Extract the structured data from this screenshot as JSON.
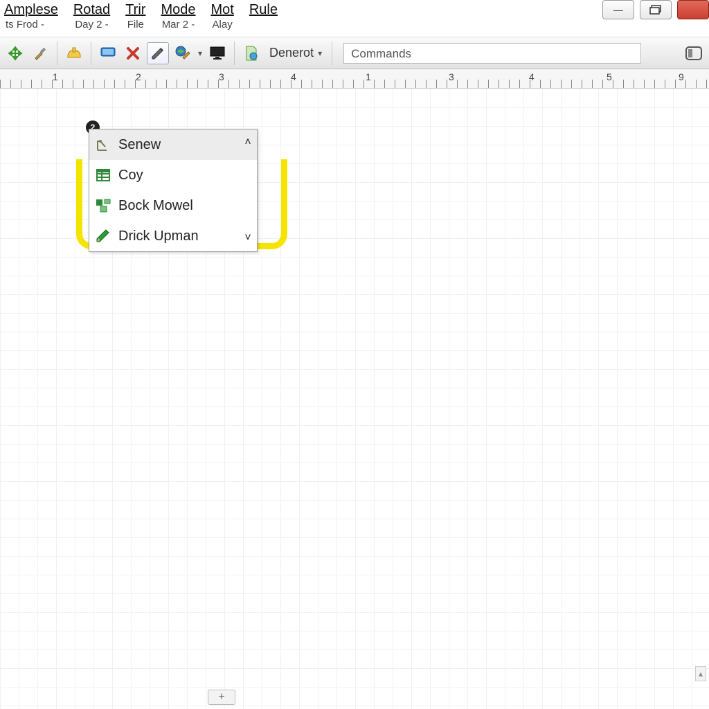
{
  "menubar": {
    "items": [
      {
        "top": "Amplese",
        "sub": "ts    Frod",
        "sub_has_caret": true
      },
      {
        "top": "Rotad",
        "sub": "Day 2",
        "sub_has_caret": true
      },
      {
        "top": "Trir",
        "sub": "File",
        "sub_has_caret": false
      },
      {
        "top": "Mode",
        "sub": "Mar 2",
        "sub_has_caret": true
      },
      {
        "top": "Mot",
        "sub": "Alay",
        "sub_has_caret": false
      },
      {
        "top": "Rule",
        "sub": "",
        "sub_has_caret": false
      }
    ]
  },
  "window_controls": {
    "minimize": "—",
    "restore": "restore",
    "close": ""
  },
  "toolbar": {
    "denerot_label": "Denerot",
    "commands_placeholder": "Commands"
  },
  "ruler": {
    "left_labels": [
      "1",
      "2",
      "3",
      "4"
    ],
    "right_labels": [
      "1",
      "3",
      "4",
      "5",
      "9"
    ]
  },
  "panel": {
    "badge": "2",
    "items": [
      {
        "label": "Senew",
        "icon": "measure-icon"
      },
      {
        "label": "Coy",
        "icon": "table-icon"
      },
      {
        "label": "Bock Mowel",
        "icon": "shapes-icon"
      },
      {
        "label": "Drick Upman",
        "icon": "pencil-icon"
      }
    ]
  },
  "colors": {
    "highlight": "#f5e400",
    "toolbar_grad_top": "#fafafa",
    "toolbar_grad_bot": "#e3e3e3"
  }
}
